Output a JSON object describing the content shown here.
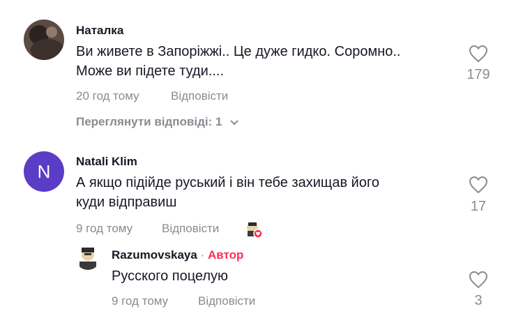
{
  "comments": [
    {
      "author": "Наталка",
      "text_line1": "Ви живете в Запоріжжі.. Це дуже гидко. Соромно..",
      "text_line2": "Може ви підете туди....",
      "time": "20 год тому",
      "reply_label": "Відповісти",
      "likes": "179",
      "view_replies": "Переглянути відповіді: 1"
    },
    {
      "author": "Natali Klim",
      "avatar_letter": "N",
      "avatar_color": "#5b3cc4",
      "text_line1": "А якщо підійде руський і він тебе захищав його",
      "text_line2": "куди відправиш",
      "time": "9 год тому",
      "reply_label": "Відповісти",
      "likes": "17"
    }
  ],
  "reply": {
    "author": "Razumovskaya",
    "separator": "·",
    "badge": "Автор",
    "text": "Русского поцелую",
    "time": "9 год тому",
    "reply_label": "Відповісти",
    "likes": "3"
  }
}
